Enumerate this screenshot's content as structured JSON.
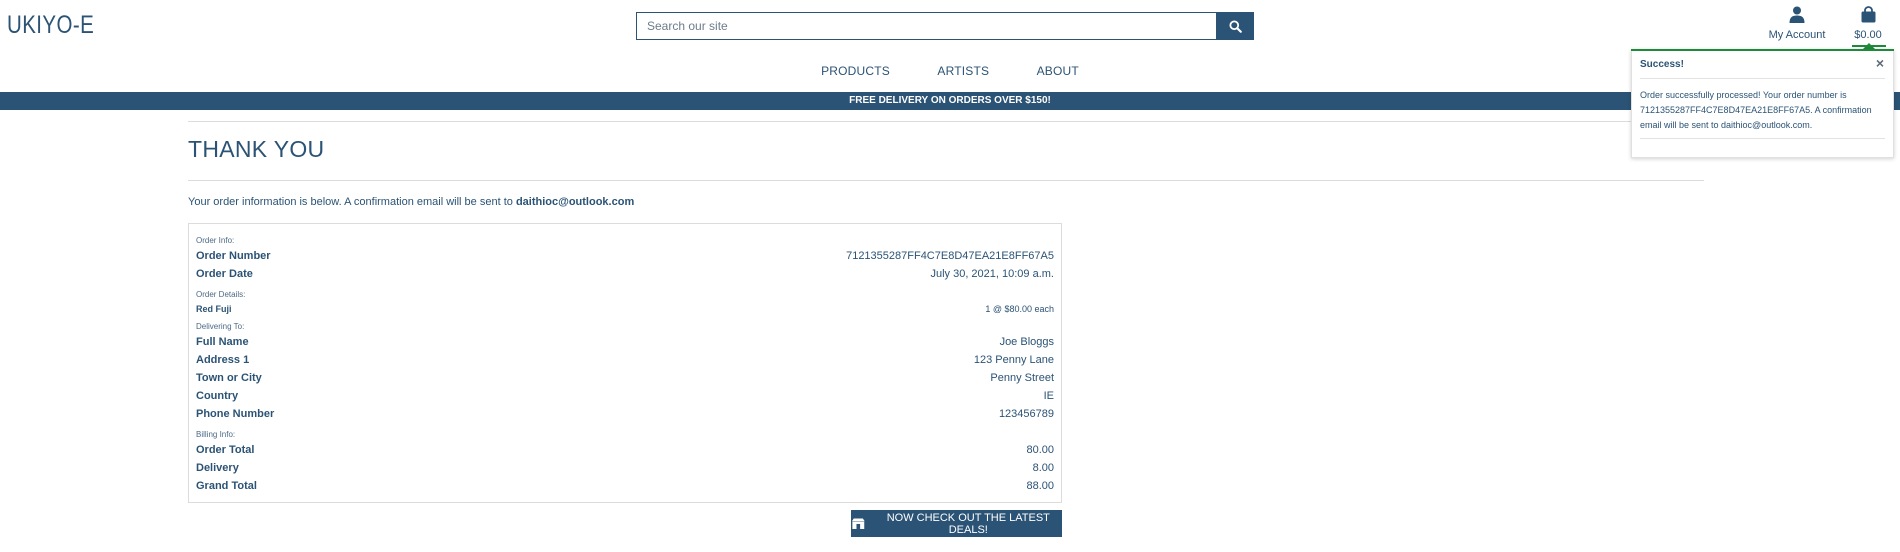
{
  "header": {
    "logo": "UKIYO-E",
    "search_placeholder": "Search our site",
    "account_label": "My Account",
    "cart_total": "$0.00"
  },
  "nav": {
    "items": [
      "PRODUCTS",
      "ARTISTS",
      "ABOUT"
    ]
  },
  "banner": "FREE DELIVERY ON ORDERS OVER $150!",
  "page": {
    "title": "THANK YOU",
    "intro_text": "Your order information is below. A confirmation email will be sent to",
    "email": "daithioc@outlook.com"
  },
  "order": {
    "order_info_label": "Order Info:",
    "order_number_label": "Order Number",
    "order_number": "7121355287FF4C7E8D47EA21E8FF67A5",
    "order_date_label": "Order Date",
    "order_date": "July 30, 2021, 10:09 a.m.",
    "order_details_label": "Order Details:",
    "item_name": "Red Fuji",
    "item_qty": "1 @ $80.00 each",
    "delivering_label": "Delivering To:",
    "full_name_label": "Full Name",
    "full_name": "Joe Bloggs",
    "address1_label": "Address 1",
    "address1": "123 Penny Lane",
    "town_label": "Town or City",
    "town": "Penny Street",
    "country_label": "Country",
    "country": "IE",
    "phone_label": "Phone Number",
    "phone": "123456789",
    "billing_label": "Billing Info:",
    "order_total_label": "Order Total",
    "order_total": "80.00",
    "delivery_label": "Delivery",
    "delivery": "8.00",
    "grand_total_label": "Grand Total",
    "grand_total": "88.00"
  },
  "deal_button": "NOW CHECK OUT THE LATEST DEALS!",
  "toast": {
    "title": "Success!",
    "message": "Order successfully processed! Your order number is 7121355287FF4C7E8D47EA21E8FF67A5. A confirmation email will be sent to daithioc@outlook.com.",
    "close": "×"
  },
  "colors": {
    "primary": "#2b5375",
    "success": "#1f8a3a"
  },
  "icons": {
    "search": "search-icon",
    "account": "user-icon",
    "cart": "shopping-bag-icon",
    "deal": "store-icon"
  }
}
